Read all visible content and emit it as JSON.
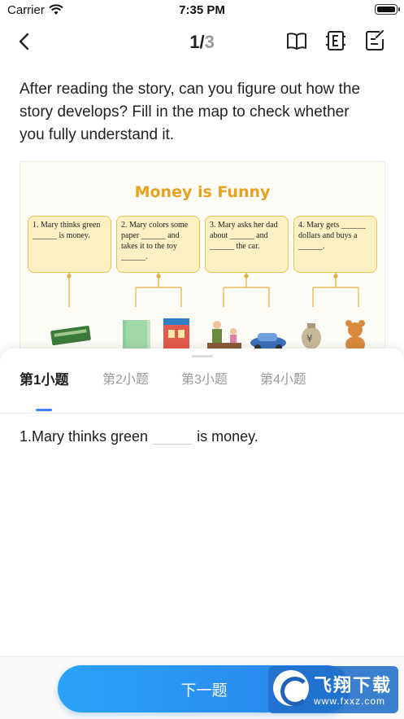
{
  "status_bar": {
    "carrier": "Carrier",
    "time": "7:35 PM"
  },
  "nav": {
    "current": "1",
    "separator": "/",
    "total": "3"
  },
  "question": "After reading the story, can you figure out how the story develops? Fill in the map to check whether you fully understand it.",
  "illustration": {
    "title": "Money is Funny",
    "boxes": [
      "1. Mary thinks green ______ is money.",
      "2. Mary colors some paper ______ and takes it to the toy ______.",
      "3. Mary asks her dad about ______ and ______ the car.",
      "4. Mary gets ______ dollars and buys a ______."
    ]
  },
  "tabs": [
    "第1小题",
    "第2小题",
    "第3小题",
    "第4小题"
  ],
  "active_tab": 0,
  "item": {
    "before": "1.Mary thinks green",
    "after": "is money."
  },
  "next_button": "下一题",
  "watermark": {
    "text": "飞翔下载",
    "url": "www.fxxz.com"
  },
  "colors": {
    "accent": "#2b84f0",
    "title_orange": "#e8a120",
    "box_fill": "#fdf1c4"
  }
}
